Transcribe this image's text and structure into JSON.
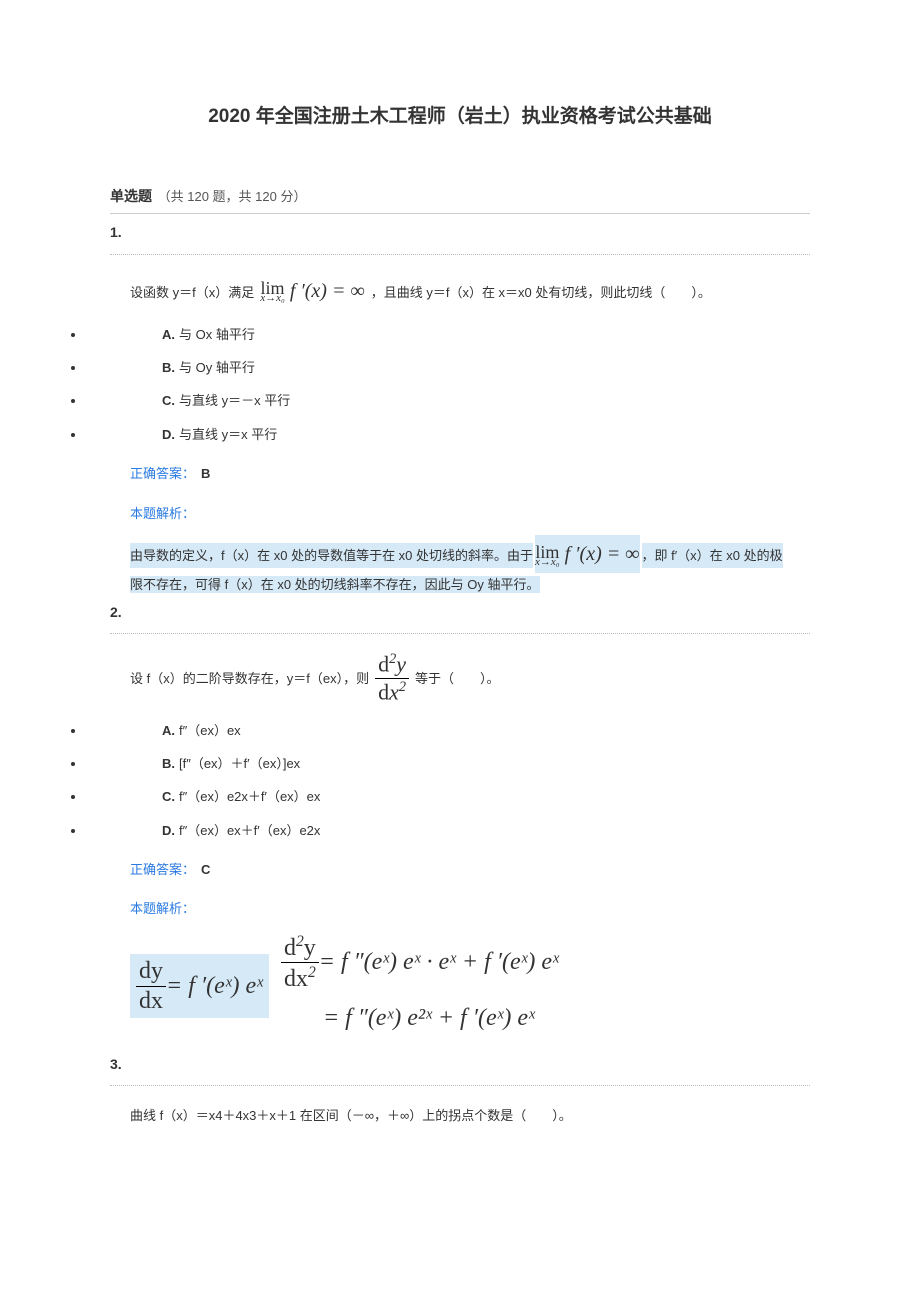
{
  "title": "2020 年全国注册土木工程师（岩土）执业资格考试公共基础",
  "section": {
    "label": "单选题",
    "meta": "（共 120 题，共 120 分）"
  },
  "q1": {
    "number": "1.",
    "pre": "设函数 y＝f（x）满足",
    "formula_top": "lim",
    "formula_sub": "x→x₀",
    "formula_right": "f ′(x) = ∞",
    "post": "，且曲线 y＝f（x）在 x＝x0 处有切线，则此切线（　　）。",
    "options": [
      {
        "label": "A.",
        "text": "与 Ox 轴平行"
      },
      {
        "label": "B.",
        "text": "与 Oy 轴平行"
      },
      {
        "label": "C.",
        "text": "与直线 y＝－x 平行"
      },
      {
        "label": "D.",
        "text": "与直线 y＝x 平行"
      }
    ],
    "answer_label": "正确答案：",
    "answer": "B",
    "explain_label": "本题解析：",
    "explain_pre": "由导数的定义，f（x）在 x0 处的导数值等于在 x0 处切线的斜率。由于",
    "explain_post": "，即 f′（x）在 x0 处的极",
    "explain_line2": "限不存在，可得 f（x）在 x0 处的切线斜率不存在，因此与 Oy 轴平行。"
  },
  "q2": {
    "number": "2.",
    "pre": "设 f（x）的二阶导数存在，y＝f（ex），则",
    "frac_num": "d²y",
    "frac_den": "dx²",
    "post": "等于（　　）。",
    "options": [
      {
        "label": "A.",
        "text": "f″（ex）ex"
      },
      {
        "label": "B.",
        "text": "[f″（ex）＋f′（ex）]ex"
      },
      {
        "label": "C.",
        "text": "f″（ex）e2x＋f′（ex）ex"
      },
      {
        "label": "D.",
        "text": "f″（ex）ex＋f′（ex）e2x"
      }
    ],
    "answer_label": "正确答案：",
    "answer": "C",
    "explain_label": "本题解析：",
    "bigformula": {
      "left_num": "dy",
      "left_den": "dx",
      "left_rhs": " = f ′(eˣ) eˣ",
      "right_top_lhs_num": "d²y",
      "right_top_lhs_den": "dx²",
      "right_top_rhs": " = f ″(eˣ) eˣ · eˣ + f ′(eˣ) eˣ",
      "right_bot": "= f ″(eˣ) e²ˣ + f ′(eˣ) eˣ"
    }
  },
  "q3": {
    "number": "3.",
    "body": "曲线 f（x）＝x4＋4x3＋x＋1 在区间（－∞，＋∞）上的拐点个数是（　　）。"
  }
}
